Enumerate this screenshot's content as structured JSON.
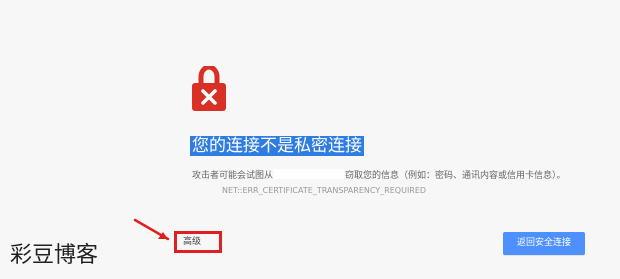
{
  "page": {
    "title": "您的连接不是私密连接",
    "description_before_mask": "攻击者可能会试图从",
    "description_after_mask": "窃取您的信息（例如：密码、通讯内容或信用卡信息）。",
    "error_code": "NET::ERR_CERTIFICATE_TRANSPARENCY_REQUIRED",
    "advanced_button_label": "高级",
    "back_button_label": "返回安全连接",
    "watermark_text": "彩豆博客"
  },
  "colors": {
    "page_background": "#f7f7f7",
    "lock_red": "#d93025",
    "title_highlight": "#2f7de1",
    "button_blue": "#4d90fe",
    "annotation_red": "#e02020"
  },
  "icons": {
    "lock_icon": "lock-icon",
    "arrow_icon": "arrow-annotation-icon"
  }
}
